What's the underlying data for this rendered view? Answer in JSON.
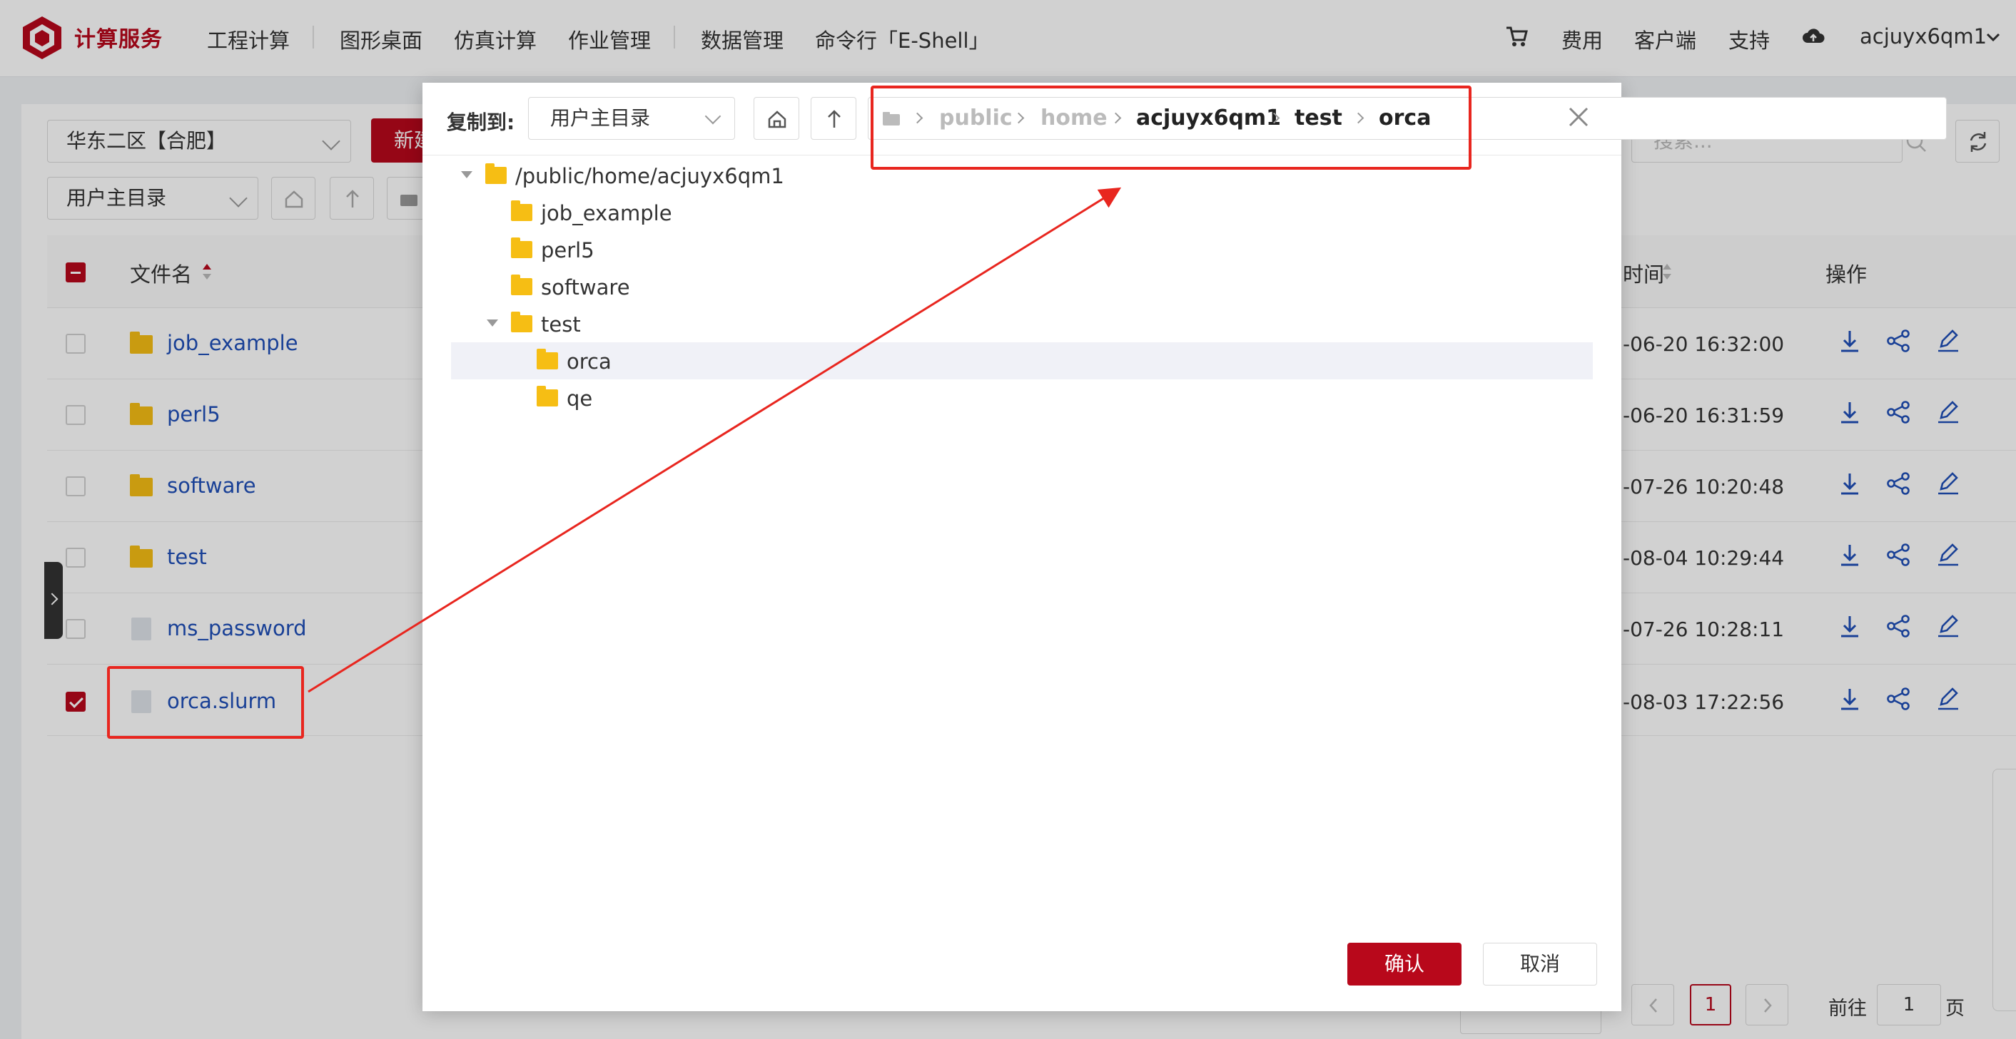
{
  "topnav": {
    "brand": "计算服务",
    "menu": [
      "工程计算",
      "图形桌面",
      "仿真计算",
      "作业管理",
      "数据管理",
      "命令行「E-Shell」"
    ],
    "right": {
      "cost": "费用",
      "client": "客户端",
      "support": "支持",
      "username": "acjuyx6qm1"
    },
    "icons": [
      "cart-icon",
      "cloud-icon",
      "chevron-down-icon"
    ]
  },
  "toolbar": {
    "region": "华东二区【合肥】",
    "new_button": "新建",
    "dir_select": "用户主目录",
    "search_placeholder": "搜索..."
  },
  "table": {
    "headers": {
      "name": "文件名",
      "time": "时间",
      "actions": "操作"
    },
    "rows": [
      {
        "name": "job_example",
        "type": "folder",
        "time": "-06-20 16:32:00",
        "checked": false
      },
      {
        "name": "perl5",
        "type": "folder",
        "time": "-06-20 16:31:59",
        "checked": false
      },
      {
        "name": "software",
        "type": "folder",
        "time": "-07-26 10:20:48",
        "checked": false
      },
      {
        "name": "test",
        "type": "folder",
        "time": "-08-04 10:29:44",
        "checked": false
      },
      {
        "name": "ms_password",
        "type": "file",
        "time": "-07-26 10:28:11",
        "checked": false
      },
      {
        "name": "orca.slurm",
        "type": "file",
        "time": "-08-03 17:22:56",
        "checked": true
      }
    ]
  },
  "pager": {
    "current": "1",
    "goto_label": "前往",
    "goto_value": "1",
    "page_suffix": "页"
  },
  "dialog": {
    "label": "复制到:",
    "dir_select": "用户主目录",
    "breadcrumb": [
      "public",
      "home",
      "acjuyx6qm1",
      "test",
      "orca"
    ],
    "tree": [
      {
        "label": "/public/home/acjuyx6qm1",
        "depth": 0,
        "expanded": true,
        "selected": false
      },
      {
        "label": "job_example",
        "depth": 1,
        "expanded": false,
        "selected": false
      },
      {
        "label": "perl5",
        "depth": 1,
        "expanded": false,
        "selected": false
      },
      {
        "label": "software",
        "depth": 1,
        "expanded": false,
        "selected": false
      },
      {
        "label": "test",
        "depth": 1,
        "expanded": true,
        "selected": false
      },
      {
        "label": "orca",
        "depth": 2,
        "expanded": false,
        "selected": true
      },
      {
        "label": "qe",
        "depth": 2,
        "expanded": false,
        "selected": false
      }
    ],
    "confirm": "确认",
    "cancel": "取消"
  },
  "colors": {
    "brand": "#b8081b",
    "link": "#1f4fb8",
    "folder": "#f6be14",
    "annotation": "#e8261f"
  }
}
